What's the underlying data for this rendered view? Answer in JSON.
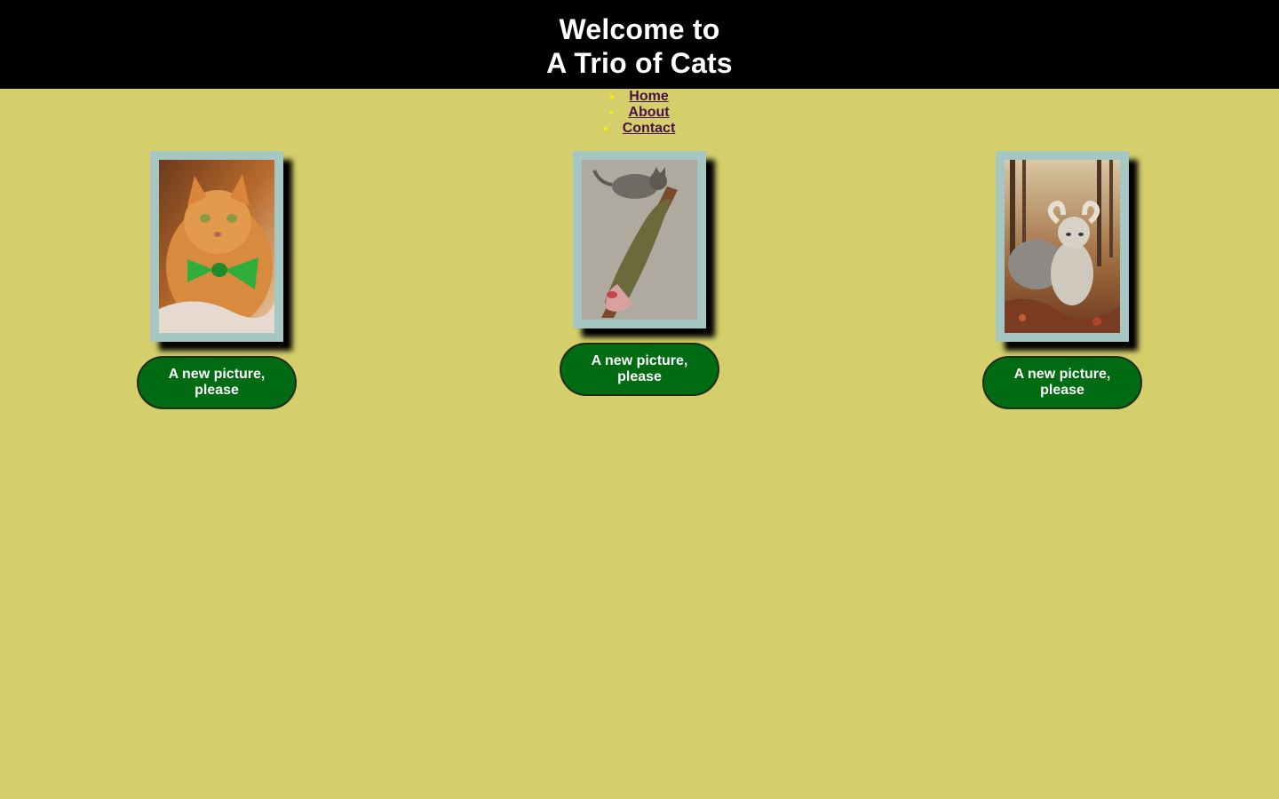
{
  "header": {
    "title_line1": "Welcome to",
    "title_line2": "A Trio of Cats"
  },
  "nav": {
    "items": [
      {
        "label": "Home"
      },
      {
        "label": "About"
      },
      {
        "label": "Contact"
      }
    ]
  },
  "cards": [
    {
      "button_label": "A new picture, please",
      "photo": "orange-cat-with-green-bowtie"
    },
    {
      "button_label": "A new picture, please",
      "photo": "tabby-cat-with-large-fish"
    },
    {
      "button_label": "A new picture, please",
      "photo": "cat-in-ram-costume-forest"
    }
  ],
  "colors": {
    "background": "#d4cf6b",
    "header": "#000000",
    "button": "#006b12",
    "frame": "#a6c6c1",
    "link": "#4a1048",
    "bullet": "#f4f400"
  }
}
